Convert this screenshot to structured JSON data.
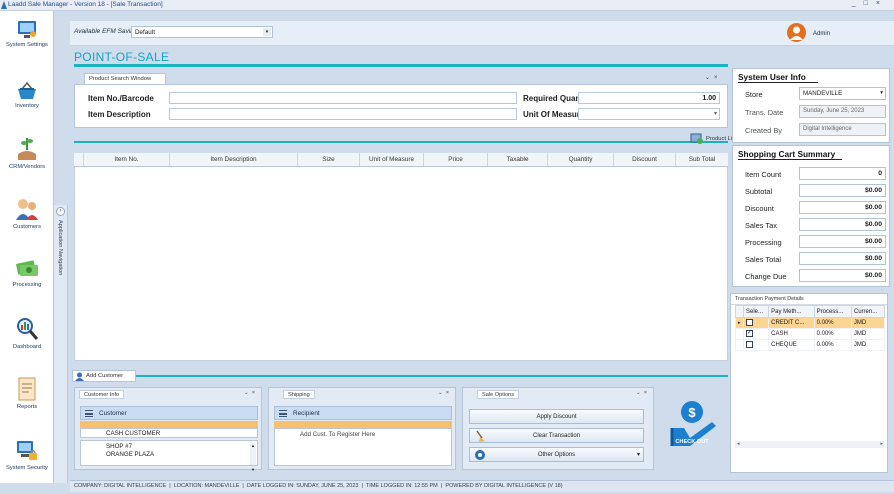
{
  "window": {
    "title": "Laadd Sale Manager - Version 18 - [Sale Transaction]",
    "controls": [
      "_",
      "□",
      "×"
    ]
  },
  "sidebar": {
    "items": [
      {
        "label": "System Settings",
        "icon": "monitor-icon"
      },
      {
        "label": "Inventory",
        "icon": "basket-icon"
      },
      {
        "label": "CRM/Vendors",
        "icon": "hand-plant-icon"
      },
      {
        "label": "Customers",
        "icon": "people-icon"
      },
      {
        "label": "Processing",
        "icon": "money-icon"
      },
      {
        "label": "Dashboard",
        "icon": "magnifier-chart-icon"
      },
      {
        "label": "Reports",
        "icon": "document-icon"
      },
      {
        "label": "System Security",
        "icon": "computer-lock-icon"
      }
    ],
    "collapse_label": "Application Navigation"
  },
  "profile": {
    "label": "Available EFM Savings",
    "value": "Default"
  },
  "user": {
    "name": "Admin"
  },
  "page": {
    "title": "POINT-OF-SALE"
  },
  "product_search": {
    "tab_label": "Product Search Window",
    "item_no_label": "Item No./Barcode",
    "item_no_value": "",
    "item_desc_label": "Item Description",
    "item_desc_value": "",
    "qty_label": "Required Quantity",
    "qty_value": "1.00",
    "uom_label": "Unit Of Measure",
    "uom_value": "",
    "product_list_label": "Product List"
  },
  "grid": {
    "columns": [
      "Item No.",
      "Item Description",
      "Size",
      "Unit of Measure",
      "Price",
      "Taxable",
      "Quantity",
      "Discount",
      "Sub Total"
    ]
  },
  "add_customer_label": "Add Customer",
  "customer_info": {
    "tab_label": "Customer Info",
    "header": "Customer",
    "name": "CASH CUSTOMER",
    "address_lines": [
      "SHOP #7",
      "ORANGE PLAZA"
    ]
  },
  "shipping": {
    "tab_label": "Shipping",
    "header": "Recipient",
    "placeholder": "Add Cust. To Register Here"
  },
  "sale_options": {
    "tab_label": "Sale Options",
    "buttons": [
      "Apply Discount",
      "Clear Transaction",
      "Other Options"
    ]
  },
  "checkout": {
    "label": "CHECK OUT"
  },
  "system_user_info": {
    "title": "System User Info",
    "store_label": "Store",
    "store_value": "MANDEVILLE",
    "trans_date_label": "Trans. Date",
    "trans_date_value": "Sunday, June 25, 2023",
    "created_by_label": "Created By",
    "created_by_value": "Digital Intelligence"
  },
  "cart_summary": {
    "title": "Shopping Cart Summary",
    "rows": [
      {
        "label": "Item Count",
        "value": "0"
      },
      {
        "label": "Subtotal",
        "value": "$0.00"
      },
      {
        "label": "Discount",
        "value": "$0.00"
      },
      {
        "label": "Sales Tax",
        "value": "$0.00"
      },
      {
        "label": "Processing",
        "value": "$0.00"
      },
      {
        "label": "Sales Total",
        "value": "$0.00"
      },
      {
        "label": "Change Due",
        "value": "$0.00"
      }
    ]
  },
  "payment_details": {
    "title": "Transaction Payment Details",
    "columns": [
      "Sele...",
      "Pay Meth...",
      "Process...",
      "Curren..."
    ],
    "rows": [
      {
        "selected": true,
        "checked": false,
        "method": "CREDIT C...",
        "process": "0.00%",
        "currency": "JMD"
      },
      {
        "selected": false,
        "checked": true,
        "method": "CASH",
        "process": "0.00%",
        "currency": "JMD"
      },
      {
        "selected": false,
        "checked": false,
        "method": "CHEQUE",
        "process": "0.00%",
        "currency": "JMD"
      }
    ]
  },
  "status_bar": {
    "items": [
      "COMPANY: DIGITAL INTELLIGENCE",
      "LOCATION: MANDEVILLE",
      "DATE LOGGED IN: SUNDAY, JUNE 25, 2023",
      "TIME LOGGED IN: 12:55 PM",
      "POWERED BY DIGITAL INTELLIGENCE (V 18)"
    ]
  }
}
